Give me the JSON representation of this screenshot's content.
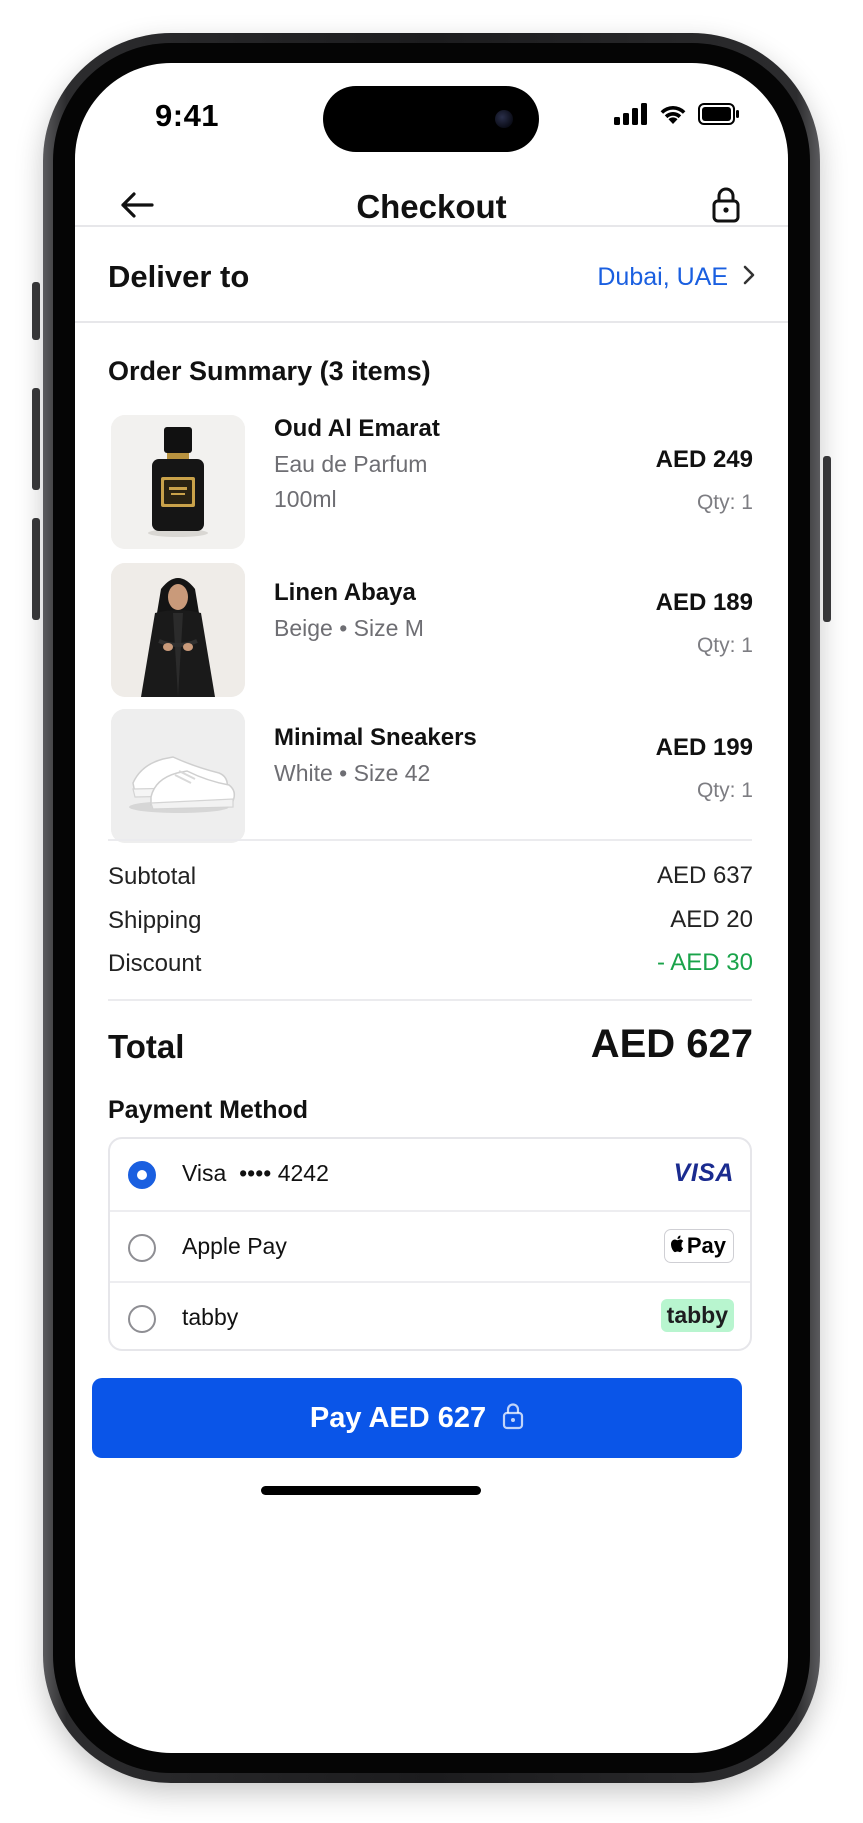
{
  "status_bar": {
    "time": "9:41"
  },
  "header": {
    "title": "Checkout",
    "back_icon": "arrow-left-icon",
    "lock_icon": "lock-icon"
  },
  "delivery": {
    "label": "Deliver to",
    "value": "Dubai, UAE",
    "link_color": "#1a5fe0"
  },
  "order_summary": {
    "title": "Order Summary (3 items)",
    "items": [
      {
        "name": "Oud Al Emarat",
        "subtitle": "Eau de Parfum",
        "detail": "100ml",
        "price": "AED 249",
        "qty": "Qty: 1",
        "image": "perfume-bottle-image"
      },
      {
        "name": "Linen Abaya",
        "subtitle": "Beige • Size M",
        "price": "AED 189",
        "qty": "Qty: 1",
        "image": "abaya-model-image"
      },
      {
        "name": "Minimal Sneakers",
        "subtitle": "White • Size 42",
        "price": "AED 199",
        "qty": "Qty: 1",
        "image": "white-sneakers-image"
      }
    ]
  },
  "totals": {
    "subtotal_label": "Subtotal",
    "subtotal_value": "AED 637",
    "shipping_label": "Shipping",
    "shipping_value": "AED 20",
    "discount_label": "Discount",
    "discount_value": "- AED 30",
    "discount_color": "#1aa34a",
    "total_label": "Total",
    "total_value": "AED 627"
  },
  "payment": {
    "title": "Payment Method",
    "selected": 0,
    "methods": [
      {
        "label": "Visa  •••• 4242",
        "logo_text": "VISA"
      },
      {
        "label": "Apple Pay",
        "logo_text": "Pay"
      },
      {
        "label": "tabby",
        "logo_text": "tabby"
      }
    ]
  },
  "pay_button": {
    "label": "Pay AED 627",
    "color": "#0a55e8"
  }
}
